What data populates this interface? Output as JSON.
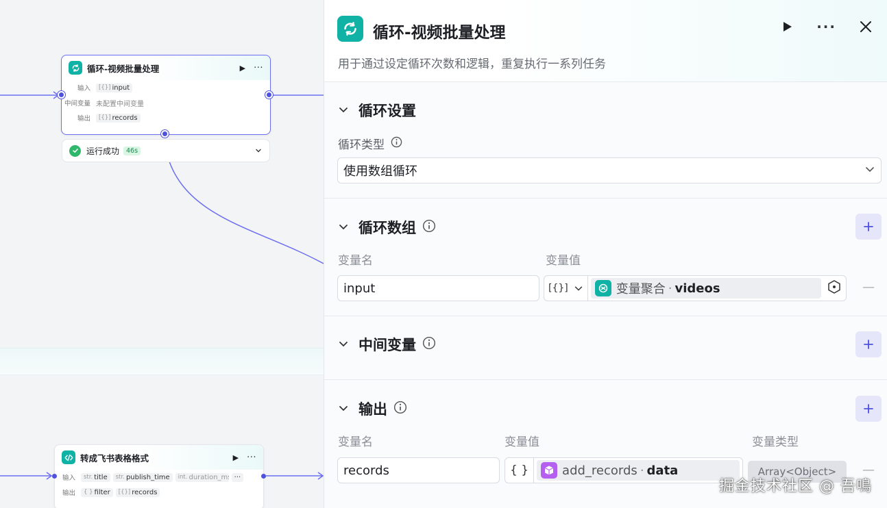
{
  "canvas": {
    "loop_node": {
      "title": "循环-视频批量处理",
      "inputs_label": "输入",
      "input_type": "[{}]",
      "input_name": "input",
      "intermediate_label": "中间变量",
      "intermediate_value": "未配置中间变量",
      "output_label": "输出",
      "output_type": "[{}]",
      "output_name": "records"
    },
    "run_status": {
      "text": "运行成功",
      "duration": "46s"
    },
    "code_node": {
      "title": "转成飞书表格格式",
      "inputs_label": "输入",
      "inputs": [
        {
          "type": "str.",
          "name": "title"
        },
        {
          "type": "str.",
          "name": "publish_time"
        },
        {
          "type": "int.",
          "name": "duration_ms"
        }
      ],
      "more": "···",
      "output_label": "输出",
      "outputs": [
        {
          "type": "{ }",
          "name": "filter"
        },
        {
          "type": "[{}]",
          "name": "records"
        }
      ]
    }
  },
  "panel": {
    "title": "循环-视频批量处理",
    "description": "用于通过设定循环次数和逻辑，重复执行一系列任务",
    "loop_settings": {
      "title": "循环设置",
      "type_label": "循环类型",
      "type_value": "使用数组循环"
    },
    "loop_array": {
      "title": "循环数组",
      "name_header": "变量名",
      "value_header": "变量值",
      "row": {
        "name": "input",
        "type_icon": "[{}]",
        "source": "变量聚合",
        "variable": "videos"
      }
    },
    "intermediate": {
      "title": "中间变量"
    },
    "output": {
      "title": "输出",
      "name_header": "变量名",
      "value_header": "变量值",
      "type_header": "变量类型",
      "row": {
        "name": "records",
        "type_icon": "{ }",
        "source": "add_records",
        "variable": "data",
        "var_type": "Array<Object>"
      }
    }
  },
  "watermark": "掘金技术社区 @ 吾鳴",
  "colors": {
    "accent": "#4e52dd",
    "node_icon": "#11b2a6",
    "success": "#2fb86b",
    "plugin_icon": "#b55ff0",
    "plus_bg": "#e6e6fb"
  }
}
